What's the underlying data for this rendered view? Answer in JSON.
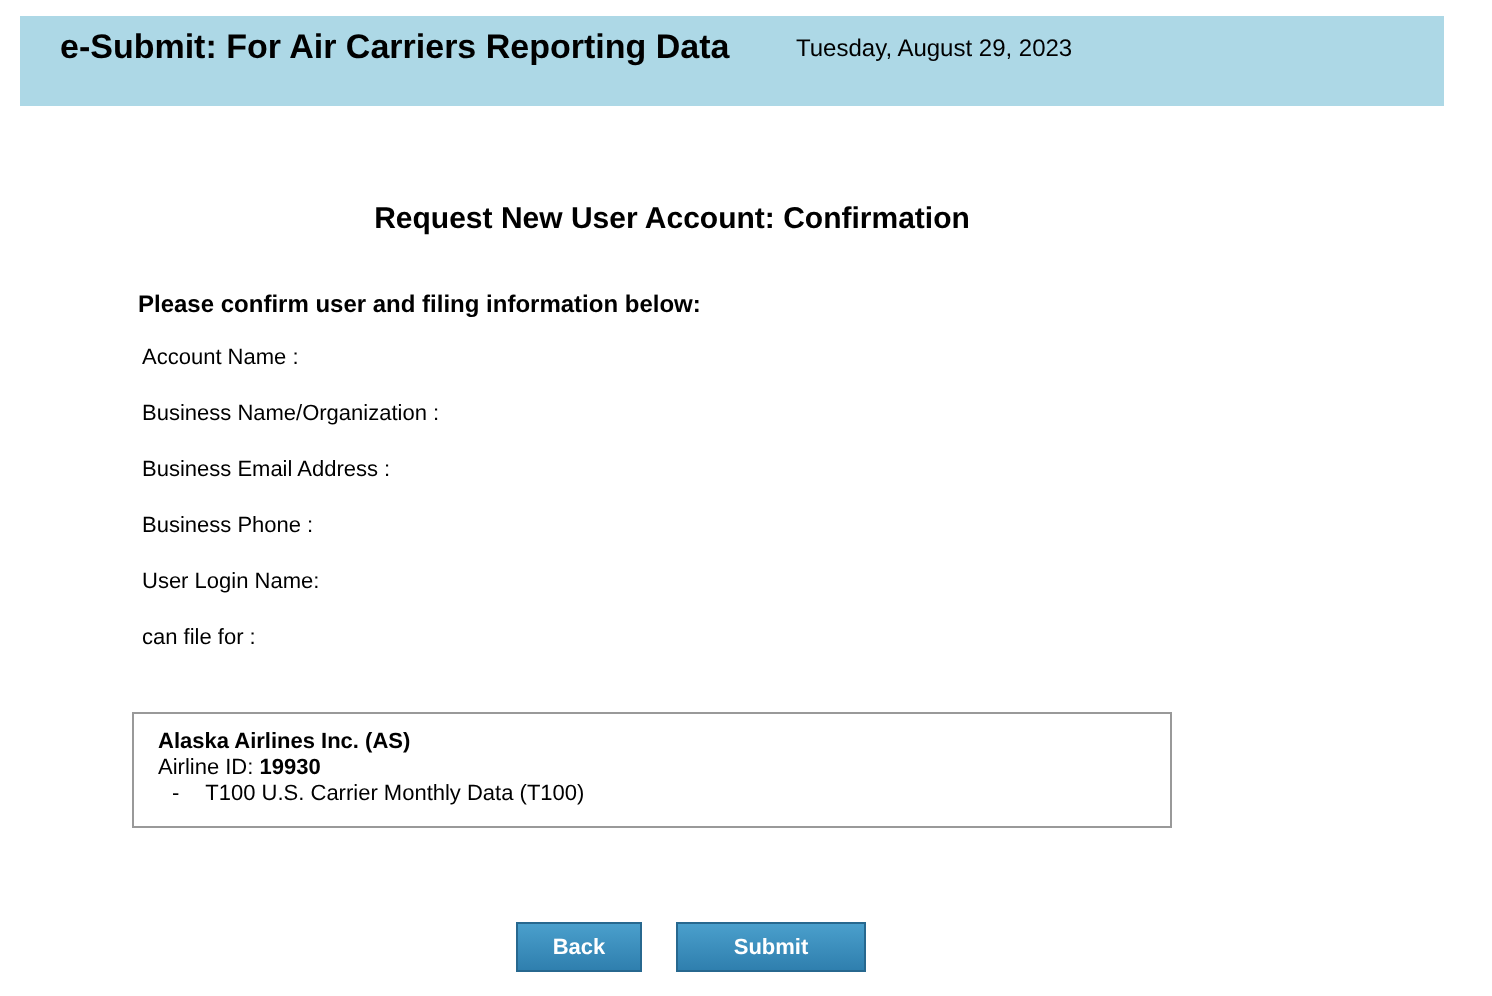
{
  "header": {
    "title": "e-Submit: For Air Carriers Reporting Data",
    "date": "Tuesday, August 29, 2023"
  },
  "page_title": "Request New User Account: Confirmation",
  "instructions": "Please confirm user and filing information below:",
  "fields": [
    {
      "label": "Account Name :"
    },
    {
      "label": "Business Name/Organization :"
    },
    {
      "label": "Business Email Address :"
    },
    {
      "label": "Business Phone :"
    },
    {
      "label": "User Login Name:"
    },
    {
      "label": "can file for :"
    }
  ],
  "carrier": {
    "name": "Alaska Airlines Inc. (AS)",
    "airline_id": "Airline ID: **19930**",
    "filings": [
      {
        "bullet": "-",
        "text": "T100 U.S. Carrier Monthly Data (T100)"
      }
    ]
  },
  "buttons": [
    {
      "label": "Back"
    },
    {
      "label": "Submit"
    }
  ]
}
